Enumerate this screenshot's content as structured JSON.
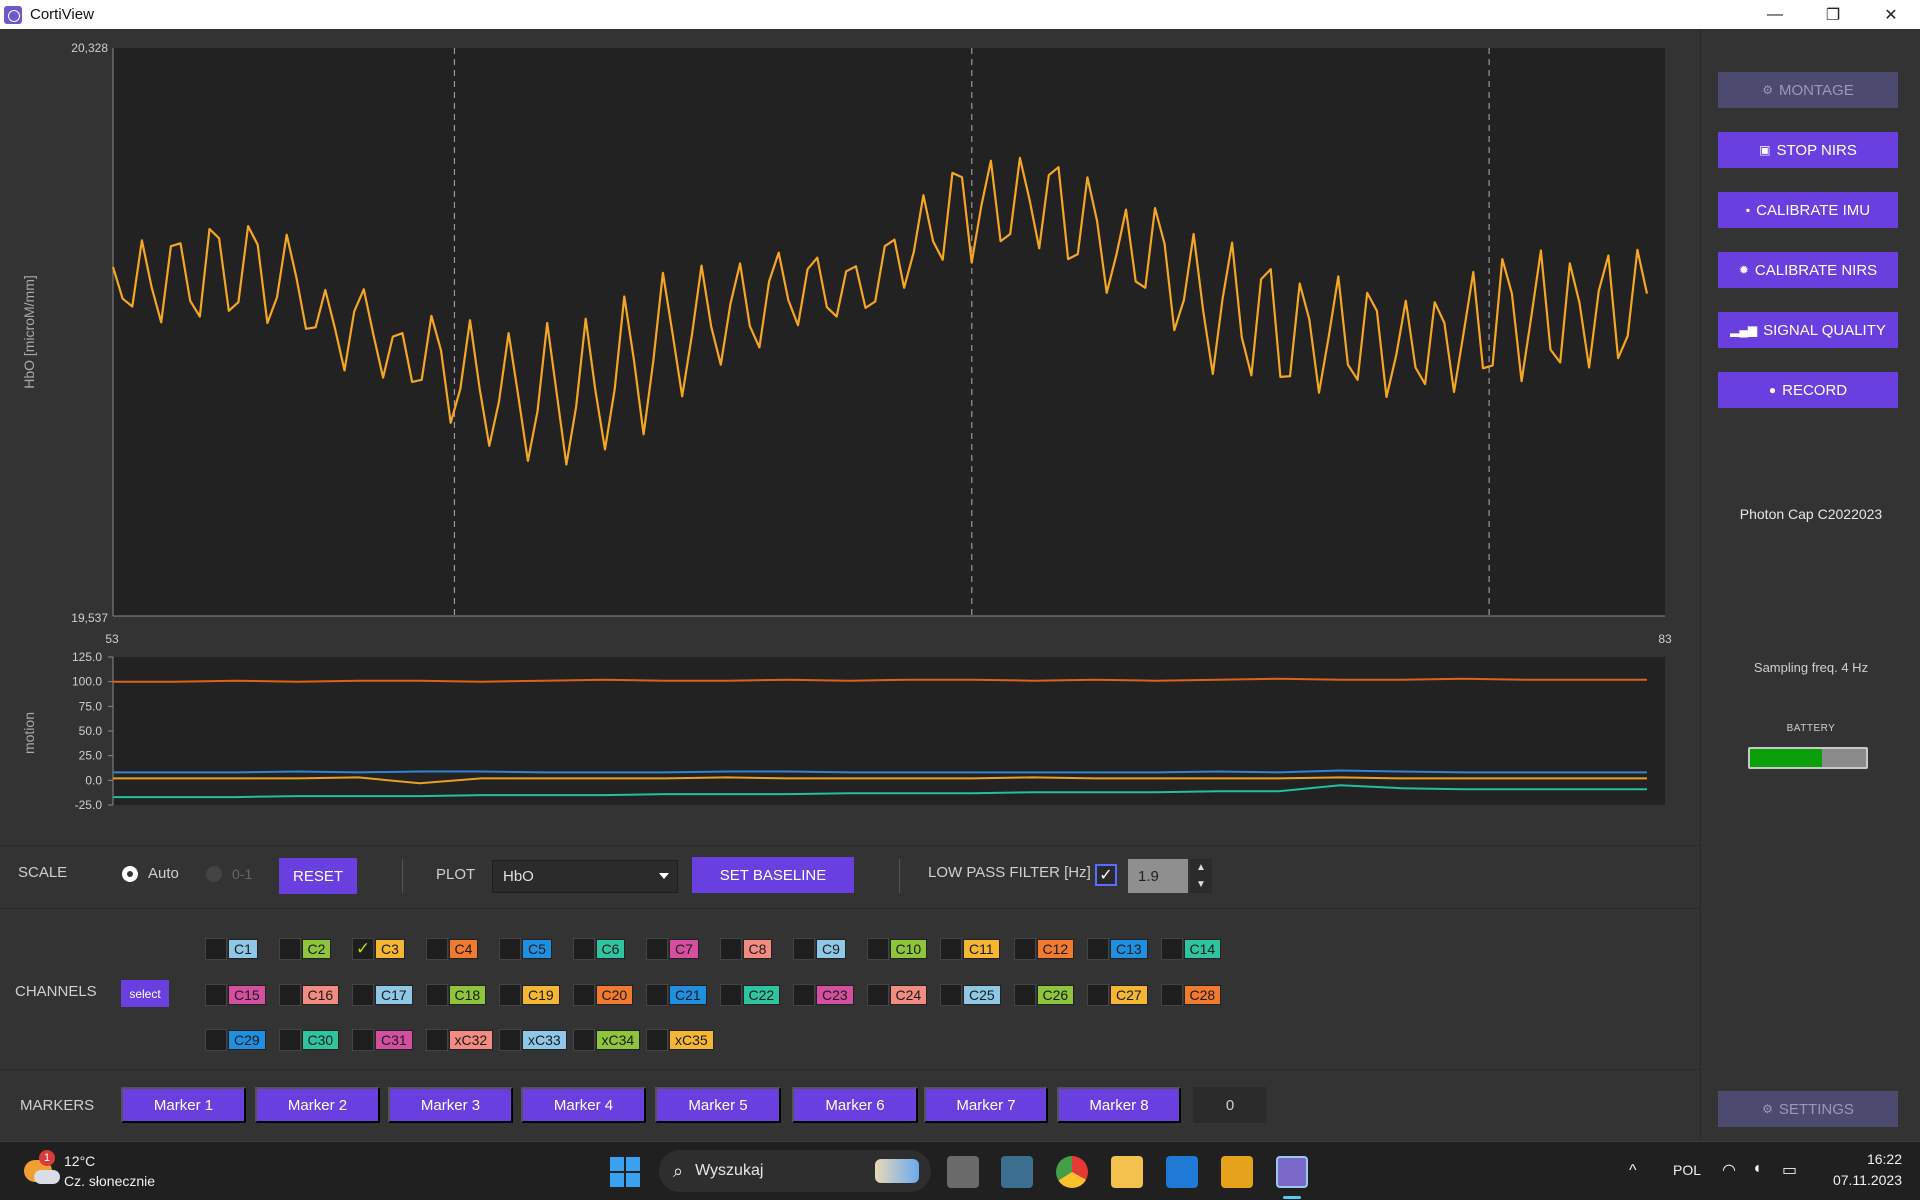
{
  "window": {
    "title": "CortiView",
    "controls": [
      "—",
      "❐",
      "✕"
    ]
  },
  "main_chart": {
    "ylabel": "HbO [microM/mm]",
    "y_top_label": "20,328",
    "y_bottom_label": "19,537",
    "x_left_label": "53",
    "x_right_label": "83",
    "line_color": "#f5a623",
    "background": "#222222"
  },
  "motion_chart": {
    "ylabel": "motion",
    "ticks": [
      "125.0",
      "100.0",
      "75.0",
      "50.0",
      "25.0",
      "0.0",
      "-25.0"
    ]
  },
  "chart_data": [
    {
      "type": "line",
      "ylabel": "HbO [microM/mm]",
      "xlim": [
        53,
        83
      ],
      "ylim": [
        19537,
        20328
      ],
      "markers_x": [
        59.6,
        69.6,
        79.6
      ],
      "series": [
        {
          "color": "#f5a623",
          "values": [
            20023,
            19979,
            19968,
            20060,
            19995,
            19946,
            20052,
            20056,
            19976,
            19954,
            20076,
            20063,
            19962,
            19974,
            20080,
            20054,
            19945,
            19981,
            20068,
            20009,
            19937,
            19939,
            19991,
            19938,
            19879,
            19961,
            19992,
            19928,
            19869,
            19926,
            19931,
            19863,
            19866,
            19955,
            19907,
            19806,
            19853,
            19949,
            19854,
            19774,
            19835,
            19931,
            19844,
            19753,
            19822,
            19945,
            19846,
            19748,
            19828,
            19951,
            19851,
            19769,
            19853,
            19982,
            19893,
            19790,
            19892,
            20015,
            19930,
            19843,
            19928,
            20025,
            19940,
            19887,
            19972,
            20028,
            19941,
            19911,
            20003,
            20043,
            19977,
            19942,
            20020,
            20036,
            19967,
            19954,
            20017,
            20024,
            19966,
            19975,
            20052,
            20061,
            19994,
            20044,
            20123,
            20059,
            20033,
            20154,
            20148,
            20029,
            20108,
            20171,
            20059,
            20069,
            20175,
            20117,
            20049,
            20151,
            20162,
            20034,
            20041,
            20148,
            20087,
            19987,
            20040,
            20103,
            20003,
            19994,
            20105,
            20055,
            19935,
            19977,
            20069,
            19962,
            19874,
            19978,
            20057,
            19925,
            19872,
            20006,
            20020,
            19870,
            19871,
            20000,
            19950,
            19848,
            19925,
            20010,
            19887,
            19866,
            19987,
            19962,
            19842,
            19900,
            19976,
            19883,
            19860,
            19974,
            19945,
            19849,
            19932,
            20016,
            19882,
            19886,
            20034,
            19986,
            19864,
            19953,
            20046,
            19908,
            19890,
            20028,
            19973,
            19883,
            19990,
            20039,
            19896,
            19927,
            20047,
            19986
          ]
        }
      ]
    },
    {
      "type": "line",
      "ylabel": "motion",
      "ylim": [
        -25,
        125
      ],
      "series": [
        {
          "color": "#e0601a",
          "values": [
            100,
            100,
            101,
            100,
            101,
            101,
            100,
            101,
            102,
            101,
            101,
            102,
            101,
            102,
            102,
            101,
            102,
            101,
            102,
            103,
            102,
            102,
            103,
            102,
            102,
            102
          ]
        },
        {
          "color": "#2e86d6",
          "values": [
            8,
            8,
            8,
            9,
            8,
            9,
            9,
            8,
            8,
            8,
            9,
            9,
            8,
            8,
            8,
            8,
            8,
            8,
            9,
            8,
            10,
            9,
            8,
            8,
            8,
            8
          ]
        },
        {
          "color": "#e8a020",
          "values": [
            2,
            2,
            2,
            2,
            3,
            -3,
            2,
            2,
            2,
            2,
            3,
            2,
            2,
            2,
            2,
            3,
            2,
            2,
            2,
            2,
            3,
            2,
            2,
            2,
            2,
            2
          ]
        },
        {
          "color": "#20c0a0",
          "values": [
            -17,
            -17,
            -17,
            -16,
            -16,
            -16,
            -15,
            -15,
            -15,
            -14,
            -14,
            -14,
            -13,
            -13,
            -13,
            -12,
            -12,
            -12,
            -11,
            -11,
            -5,
            -8,
            -9,
            -9,
            -9,
            -9
          ]
        }
      ]
    }
  ],
  "right_panel": {
    "buttons": [
      {
        "label": "MONTAGE",
        "icon": "gear-icon",
        "glyph": "⚙",
        "disabled": true
      },
      {
        "label": "STOP NIRS",
        "icon": "cast-icon",
        "glyph": "▣",
        "disabled": false
      },
      {
        "label": "CALIBRATE IMU",
        "icon": "chip-icon",
        "glyph": "▪",
        "disabled": false
      },
      {
        "label": "CALIBRATE NIRS",
        "icon": "sun-icon",
        "glyph": "✹",
        "disabled": false
      },
      {
        "label": "SIGNAL QUALITY",
        "icon": "signal-bars-icon",
        "glyph": "▂▄▆",
        "disabled": false
      },
      {
        "label": "RECORD",
        "icon": "record-dot-icon",
        "glyph": "●",
        "disabled": false
      }
    ],
    "device": "Photon Cap C2022023",
    "sampling": "Sampling freq. 4 Hz",
    "battery_label": "BATTERY",
    "battery_level": 0.62,
    "settings": {
      "label": "SETTINGS",
      "glyph": "⚙"
    }
  },
  "controls": {
    "scale_label": "SCALE",
    "auto_label": "Auto",
    "zero_one_label": "0-1",
    "reset_label": "RESET",
    "plot_label": "PLOT",
    "plot_value": "HbO",
    "set_baseline_label": "SET BASELINE",
    "lpf_label": "LOW PASS FILTER [Hz]",
    "lpf_value": "1.9",
    "lpf_checked": "✓"
  },
  "channels": {
    "label": "CHANNELS",
    "select_label": "select",
    "rows": [
      [
        {
          "name": "C1",
          "color": "#8ec8e6"
        },
        {
          "name": "C2",
          "color": "#8fc53a"
        },
        {
          "name": "C3",
          "color": "#f5b731",
          "checked": true
        },
        {
          "name": "C4",
          "color": "#f07a2e"
        },
        {
          "name": "C5",
          "color": "#1f8fe0"
        },
        {
          "name": "C6",
          "color": "#2ec4a0"
        },
        {
          "name": "C7",
          "color": "#d44fa0"
        },
        {
          "name": "C8",
          "color": "#f28b82"
        },
        {
          "name": "C9",
          "color": "#8ec8e6"
        },
        {
          "name": "C10",
          "color": "#8fc53a"
        },
        {
          "name": "C11",
          "color": "#f5b731"
        },
        {
          "name": "C12",
          "color": "#f07a2e"
        },
        {
          "name": "C13",
          "color": "#1f8fe0"
        },
        {
          "name": "C14",
          "color": "#2ec4a0"
        }
      ],
      [
        {
          "name": "C15",
          "color": "#d44fa0"
        },
        {
          "name": "C16",
          "color": "#f28b82"
        },
        {
          "name": "C17",
          "color": "#8ec8e6"
        },
        {
          "name": "C18",
          "color": "#8fc53a"
        },
        {
          "name": "C19",
          "color": "#f5b731"
        },
        {
          "name": "C20",
          "color": "#f07a2e"
        },
        {
          "name": "C21",
          "color": "#1f8fe0"
        },
        {
          "name": "C22",
          "color": "#2ec4a0"
        },
        {
          "name": "C23",
          "color": "#d44fa0"
        },
        {
          "name": "C24",
          "color": "#f28b82"
        },
        {
          "name": "C25",
          "color": "#8ec8e6"
        },
        {
          "name": "C26",
          "color": "#8fc53a"
        },
        {
          "name": "C27",
          "color": "#f5b731"
        },
        {
          "name": "C28",
          "color": "#f07a2e"
        }
      ],
      [
        {
          "name": "C29",
          "color": "#1f8fe0"
        },
        {
          "name": "C30",
          "color": "#2ec4a0"
        },
        {
          "name": "C31",
          "color": "#d44fa0"
        },
        {
          "name": "xC32",
          "color": "#f28b82"
        },
        {
          "name": "xC33",
          "color": "#8ec8e6"
        },
        {
          "name": "xC34",
          "color": "#8fc53a"
        },
        {
          "name": "xC35",
          "color": "#f5b731"
        }
      ]
    ]
  },
  "markers": {
    "label": "MARKERS",
    "buttons": [
      "Marker 1",
      "Marker 2",
      "Marker 3",
      "Marker 4",
      "Marker 5",
      "Marker 6",
      "Marker 7",
      "Marker 8"
    ],
    "count": "0"
  },
  "taskbar": {
    "weather_temp": "12°C",
    "weather_desc": "Cz. słonecznie",
    "weather_badge": "1",
    "search_placeholder": "Wyszukaj",
    "language": "POL",
    "time": "16:22",
    "date": "07.11.2023",
    "chevron": "^"
  }
}
